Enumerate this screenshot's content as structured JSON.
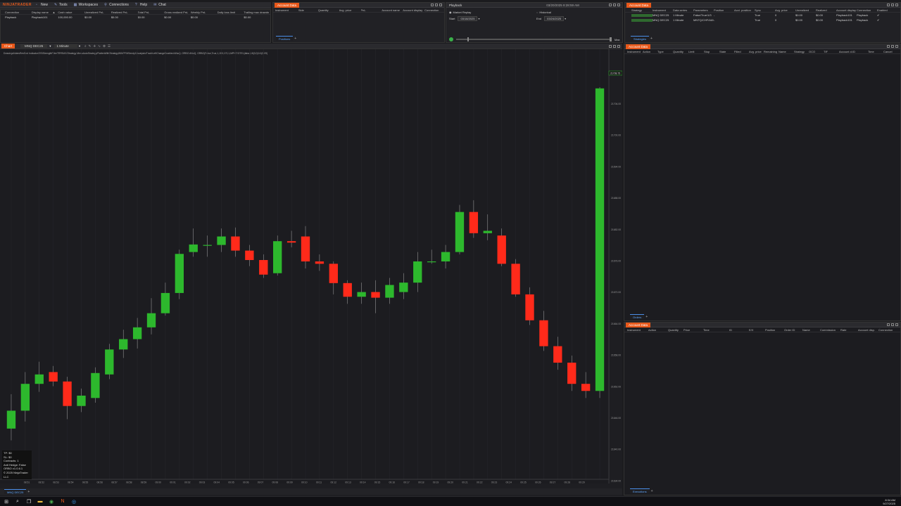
{
  "control_center": {
    "logo": "NINJATRADER",
    "menu": [
      {
        "label": "New",
        "icon": "new-icon"
      },
      {
        "label": "Tools",
        "icon": "tools-icon"
      },
      {
        "label": "Workspaces",
        "icon": "workspaces-icon"
      },
      {
        "label": "Connections",
        "icon": "connections-icon"
      },
      {
        "label": "Help",
        "icon": "help-icon"
      },
      {
        "label": "Chat",
        "icon": "chat-icon"
      }
    ],
    "accounts_headers": [
      "Connection",
      "Display name",
      "▲",
      "Cash value",
      "Unrealized PnL",
      "Realized PnL",
      "Total PnL",
      "Gross realized PnL",
      "Weekly PnL",
      "Daily loss limit",
      "Trailing max drawdn"
    ],
    "accounts_row": [
      "Playback",
      "Playback101",
      "",
      "100,000.00",
      "$0.00",
      "$0.00",
      "$0.00",
      "$0.00",
      "$0.00",
      "",
      "$0.00"
    ]
  },
  "account_data_top": {
    "title": "Account Data",
    "headers": [
      "Instrument",
      "Side",
      "Quantity",
      "Avg. price",
      "PnL",
      "Account name",
      "Account display",
      "Connection"
    ],
    "tab_positions": "Positions"
  },
  "playback": {
    "title": "Playback",
    "market_replay": "Market Replay",
    "historical": "Historical",
    "start_label": "Start",
    "start_value": "03/18/2025",
    "end_label": "End",
    "end_value": "03/24/2025",
    "clock": "03/20/2025 8:28:59 AM",
    "max_label": "Max"
  },
  "account_data_strategies": {
    "title": "Account Data",
    "headers": [
      "Strategy",
      "Instrument",
      "Data series",
      "Parameters",
      "Position",
      "Acct. position",
      "Sync",
      "Avg. price",
      "Unrealized",
      "Realized",
      "Account display",
      "Connection",
      "Enabled"
    ],
    "rows": [
      [
        "",
        "MNQ DEC25",
        "1 Minute",
        "False/True/1/3",
        "-",
        "",
        "True",
        "0",
        "$0.00",
        "$0.00",
        "Playback101",
        "Playback",
        "✔"
      ],
      [
        "",
        "MNQ DEC25",
        "1 Minute",
        "MNTQ/CHF/All/4",
        "-",
        "",
        "True",
        "0",
        "$0.00",
        "$0.00",
        "Playback101",
        "Playback",
        "✔"
      ]
    ],
    "tab_strategies": "Strategies"
  },
  "chart": {
    "title": "Chart",
    "instrument": "MNQ DEC25",
    "interval": "1 Minute",
    "indicator_label": "DrawingsNotesRevEnd Indicator/RSIStrengthFilterTRRSAS/Strategy MenuAutoStrategy/FlattenWithStrategyWIMPFMSendyCAnalysis/TradeLeftChangeEnabled ANaQ, ORBO ANaQ, ORBO(False,True,1,150,170,1,MPHT/OTEL)false,15(0,0)0.0(0.09)",
    "tab": "MNQ DEC25",
    "info_box": [
      "TP: $0",
      "SL: $0",
      "Contracts: 1",
      "Anti Hedge: False",
      "ORBO v1.0.6.1",
      "© 2025 NinjaTrader LLC"
    ],
    "price_labels": [
      "21706.00",
      "21700.00",
      "21694.00",
      "21688.00",
      "21682.00",
      "21676.00",
      "21670.00",
      "21664.00",
      "21658.00",
      "21652.00",
      "21646.00",
      "21640.00",
      "21634.00"
    ],
    "last_price_label": "21708.75",
    "time_labels": [
      "08:51",
      "08:52",
      "08:53",
      "08:54",
      "08:55",
      "08:56",
      "08:57",
      "08:58",
      "08:59",
      "09:00",
      "09:01",
      "09:02",
      "09:03",
      "09:04",
      "09:05",
      "09:06",
      "09:07",
      "09:08",
      "09:09",
      "09:10",
      "09:11",
      "09:12",
      "09:13",
      "09:14",
      "09:15",
      "09:16",
      "09:17",
      "09:18",
      "09:19",
      "09:20",
      "09:21",
      "09:22",
      "09:23",
      "09:24",
      "09:25",
      "09:26",
      "09:27",
      "09:28",
      "09:29"
    ]
  },
  "chart_data": {
    "type": "candlestick",
    "x_label": "time",
    "candles": [
      {
        "t": "08:51",
        "o": 21636.5,
        "h": 21643.8,
        "l": 21634.0,
        "c": 21640.3
      },
      {
        "t": "08:52",
        "o": 21640.3,
        "h": 21648.5,
        "l": 21638.0,
        "c": 21646.0
      },
      {
        "t": "08:53",
        "o": 21646.0,
        "h": 21650.7,
        "l": 21644.3,
        "c": 21648.0
      },
      {
        "t": "08:54",
        "o": 21648.5,
        "h": 21649.8,
        "l": 21645.5,
        "c": 21646.5
      },
      {
        "t": "08:55",
        "o": 21646.5,
        "h": 21647.5,
        "l": 21638.5,
        "c": 21641.3
      },
      {
        "t": "08:56",
        "o": 21641.3,
        "h": 21645.0,
        "l": 21640.0,
        "c": 21643.5
      },
      {
        "t": "08:57",
        "o": 21643.0,
        "h": 21649.5,
        "l": 21642.0,
        "c": 21648.3
      },
      {
        "t": "08:58",
        "o": 21648.0,
        "h": 21654.5,
        "l": 21647.0,
        "c": 21653.3
      },
      {
        "t": "08:59",
        "o": 21653.3,
        "h": 21657.5,
        "l": 21651.5,
        "c": 21655.5
      },
      {
        "t": "09:00",
        "o": 21655.5,
        "h": 21660.0,
        "l": 21653.5,
        "c": 21658.0
      },
      {
        "t": "09:01",
        "o": 21658.0,
        "h": 21664.2,
        "l": 21656.5,
        "c": 21661.0
      },
      {
        "t": "09:02",
        "o": 21661.0,
        "h": 21667.5,
        "l": 21660.5,
        "c": 21665.3
      },
      {
        "t": "09:03",
        "o": 21665.3,
        "h": 21674.5,
        "l": 21664.0,
        "c": 21673.6
      },
      {
        "t": "09:04",
        "o": 21674.0,
        "h": 21679.0,
        "l": 21673.0,
        "c": 21675.6
      },
      {
        "t": "09:05",
        "o": 21675.5,
        "h": 21677.5,
        "l": 21673.0,
        "c": 21675.5
      },
      {
        "t": "09:06",
        "o": 21675.5,
        "h": 21679.0,
        "l": 21674.0,
        "c": 21677.3
      },
      {
        "t": "09:07",
        "o": 21677.3,
        "h": 21679.2,
        "l": 21673.0,
        "c": 21674.3
      },
      {
        "t": "09:08",
        "o": 21674.3,
        "h": 21675.5,
        "l": 21671.0,
        "c": 21672.3
      },
      {
        "t": "09:09",
        "o": 21672.3,
        "h": 21673.5,
        "l": 21668.5,
        "c": 21669.2
      },
      {
        "t": "09:10",
        "o": 21669.5,
        "h": 21677.5,
        "l": 21669.0,
        "c": 21676.3
      },
      {
        "t": "09:11",
        "o": 21676.3,
        "h": 21678.5,
        "l": 21675.0,
        "c": 21676.0
      },
      {
        "t": "09:12",
        "o": 21677.3,
        "h": 21679.5,
        "l": 21670.5,
        "c": 21672.0
      },
      {
        "t": "09:13",
        "o": 21672.0,
        "h": 21673.5,
        "l": 21670.0,
        "c": 21671.5
      },
      {
        "t": "09:14",
        "o": 21671.5,
        "h": 21672.0,
        "l": 21665.0,
        "c": 21667.4
      },
      {
        "t": "09:15",
        "o": 21667.4,
        "h": 21668.0,
        "l": 21663.0,
        "c": 21664.5
      },
      {
        "t": "09:16",
        "o": 21664.5,
        "h": 21667.5,
        "l": 21663.0,
        "c": 21665.5
      },
      {
        "t": "09:17",
        "o": 21665.5,
        "h": 21668.0,
        "l": 21661.0,
        "c": 21664.3
      },
      {
        "t": "09:18",
        "o": 21664.3,
        "h": 21668.5,
        "l": 21663.0,
        "c": 21667.0
      },
      {
        "t": "09:19",
        "o": 21665.5,
        "h": 21669.5,
        "l": 21664.0,
        "c": 21667.5
      },
      {
        "t": "09:20",
        "o": 21667.5,
        "h": 21674.0,
        "l": 21665.5,
        "c": 21672.0
      },
      {
        "t": "09:21",
        "o": 21672.0,
        "h": 21674.5,
        "l": 21671.5,
        "c": 21672.0
      },
      {
        "t": "09:22",
        "o": 21672.0,
        "h": 21675.5,
        "l": 21670.5,
        "c": 21674.0
      },
      {
        "t": "09:23",
        "o": 21674.0,
        "h": 21684.0,
        "l": 21673.5,
        "c": 21682.5
      },
      {
        "t": "09:24",
        "o": 21682.5,
        "h": 21685.0,
        "l": 21677.0,
        "c": 21678.0
      },
      {
        "t": "09:25",
        "o": 21678.0,
        "h": 21682.0,
        "l": 21676.5,
        "c": 21678.5
      },
      {
        "t": "09:26",
        "o": 21677.5,
        "h": 21679.0,
        "l": 21671.0,
        "c": 21671.5
      },
      {
        "t": "09:27",
        "o": 21671.5,
        "h": 21672.5,
        "l": 21664.5,
        "c": 21665.0
      },
      {
        "t": "09:28",
        "o": 21665.0,
        "h": 21666.5,
        "l": 21658.5,
        "c": 21659.5
      },
      {
        "t": "09:29",
        "o": 21659.5,
        "h": 21661.5,
        "l": 21653.0,
        "c": 21654.0
      },
      {
        "t": "09:30",
        "o": 21654.0,
        "h": 21656.0,
        "l": 21649.0,
        "c": 21650.5
      },
      {
        "t": "09:31",
        "o": 21650.5,
        "h": 21652.0,
        "l": 21644.5,
        "c": 21646.0
      },
      {
        "t": "09:32",
        "o": 21646.0,
        "h": 21648.5,
        "l": 21643.0,
        "c": 21644.5
      },
      {
        "t": "09:33",
        "o": 21644.5,
        "h": 21709.0,
        "l": 21643.0,
        "c": 21708.75
      }
    ],
    "y_range": [
      21632.0,
      21712.0
    ],
    "colors": {
      "up": "#2db82d",
      "down": "#ff2a1a",
      "wick": "#aaaaaa"
    }
  },
  "account_data_orders": {
    "title": "Account Data",
    "headers": [
      "Instrument",
      "Action",
      "Type",
      "Quantity",
      "Limit",
      "Stop",
      "State",
      "Filled",
      "Avg. price",
      "Remaining",
      "Name",
      "Strategy",
      "OCO",
      "TIF",
      "Account d.",
      "ID",
      "Time",
      "Cancel"
    ],
    "tab_orders": "Orders"
  },
  "account_data_executions": {
    "title": "Account Data",
    "headers": [
      "Instrument",
      "Action",
      "Quantity",
      "Price",
      "Time",
      "",
      "ID",
      "E/X",
      "Position",
      "Order ID",
      "Name",
      "Commission",
      "Rate",
      "Account disp.",
      "Connection"
    ],
    "tab_executions": "Executions"
  },
  "taskbar": {
    "time": "8:34 AM",
    "date": "9/27/2025"
  }
}
